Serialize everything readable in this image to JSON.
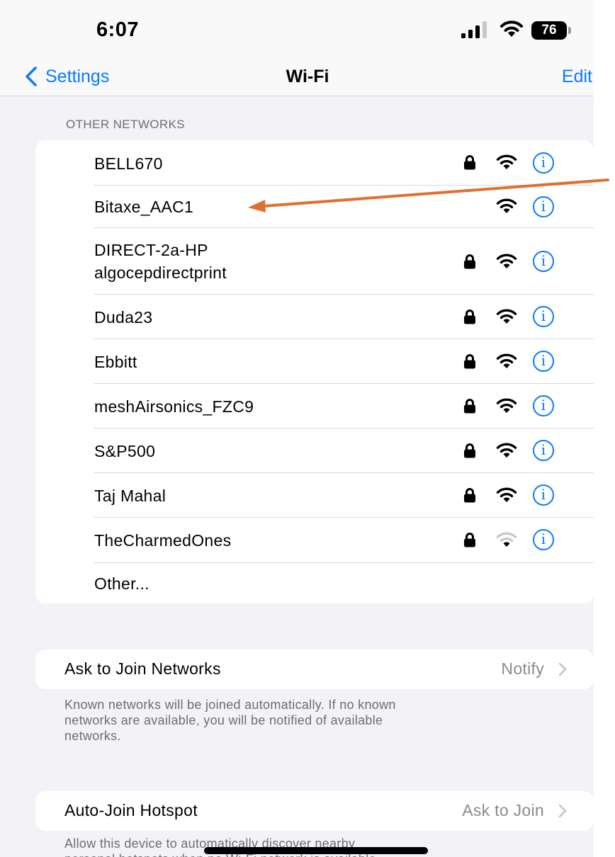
{
  "status_bar": {
    "time": "6:07",
    "battery": "76",
    "icons": [
      "signal-icon",
      "wifi-icon",
      "battery-icon"
    ]
  },
  "nav": {
    "back_label": "Settings",
    "title": "Wi-Fi",
    "edit_label": "Edit"
  },
  "other_networks": {
    "header": "OTHER NETWORKS",
    "networks": [
      {
        "name": "BELL670",
        "locked": true,
        "signal": "strong"
      },
      {
        "name": "Bitaxe_AAC1",
        "locked": false,
        "signal": "strong"
      },
      {
        "name_line1": "DIRECT-2a-HP",
        "name_line2": "algocepdirectprint",
        "locked": true,
        "signal": "strong"
      },
      {
        "name": "Duda23",
        "locked": true,
        "signal": "strong"
      },
      {
        "name": "Ebbitt",
        "locked": true,
        "signal": "strong"
      },
      {
        "name": "meshAirsonics_FZC9",
        "locked": true,
        "signal": "strong"
      },
      {
        "name": "S&P500",
        "locked": true,
        "signal": "strong"
      },
      {
        "name": "Taj Mahal",
        "locked": true,
        "signal": "strong"
      },
      {
        "name": "TheCharmedOnes",
        "locked": true,
        "signal": "weak"
      }
    ],
    "other_label": "Other...",
    "info_glyph": "i"
  },
  "ask_to_join": {
    "label": "Ask to Join Networks",
    "value": "Notify",
    "footnote_line1": "Known networks will be joined automatically. If no known",
    "footnote_line2": "networks are available, you will be notified of available",
    "footnote_line3": "networks."
  },
  "auto_join_hotspot": {
    "label": "Auto-Join Hotspot",
    "value": "Ask to Join",
    "footnote_line1": "Allow this device to automatically discover nearby",
    "footnote_line2": "personal hotspots when no Wi-Fi network is available."
  },
  "colors": {
    "accent": "#0a7aff",
    "annotation_arrow": "#e07031",
    "background": "#f2f2f7"
  }
}
